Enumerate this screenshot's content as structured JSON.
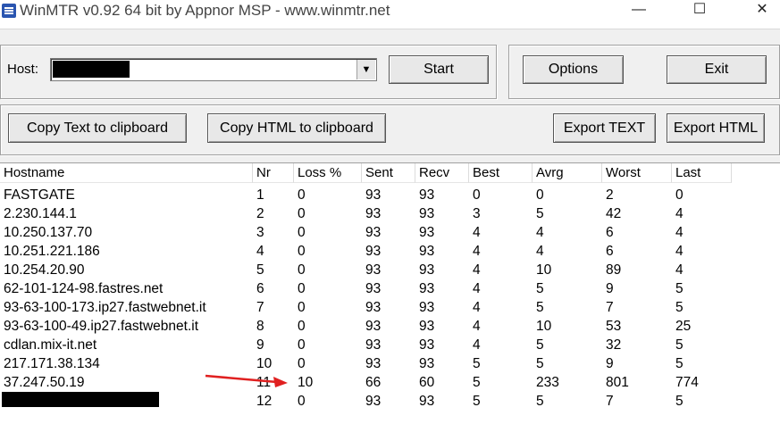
{
  "window": {
    "title": "WinMTR v0.92 64 bit by Appnor MSP - www.winmtr.net",
    "minimize_glyph": "—",
    "maximize_glyph": "☐",
    "close_glyph": "✕"
  },
  "host": {
    "label": "Host:",
    "value": "",
    "dropdown_glyph": "▼"
  },
  "buttons": {
    "start": "Start",
    "options": "Options",
    "exit": "Exit",
    "copy_text": "Copy Text to clipboard",
    "copy_html": "Copy HTML to clipboard",
    "export_text": "Export TEXT",
    "export_html": "Export HTML"
  },
  "table": {
    "columns": [
      "Hostname",
      "Nr",
      "Loss %",
      "Sent",
      "Recv",
      "Best",
      "Avrg",
      "Worst",
      "Last"
    ],
    "rows": [
      [
        "FASTGATE",
        "1",
        "0",
        "93",
        "93",
        "0",
        "0",
        "2",
        "0"
      ],
      [
        "2.230.144.1",
        "2",
        "0",
        "93",
        "93",
        "3",
        "5",
        "42",
        "4"
      ],
      [
        "10.250.137.70",
        "3",
        "0",
        "93",
        "93",
        "4",
        "4",
        "6",
        "4"
      ],
      [
        "10.251.221.186",
        "4",
        "0",
        "93",
        "93",
        "4",
        "4",
        "6",
        "4"
      ],
      [
        "10.254.20.90",
        "5",
        "0",
        "93",
        "93",
        "4",
        "10",
        "89",
        "4"
      ],
      [
        "62-101-124-98.fastres.net",
        "6",
        "0",
        "93",
        "93",
        "4",
        "5",
        "9",
        "5"
      ],
      [
        "93-63-100-173.ip27.fastwebnet.it",
        "7",
        "0",
        "93",
        "93",
        "4",
        "5",
        "7",
        "5"
      ],
      [
        "93-63-100-49.ip27.fastwebnet.it",
        "8",
        "0",
        "93",
        "93",
        "4",
        "10",
        "53",
        "25"
      ],
      [
        "cdlan.mix-it.net",
        "9",
        "0",
        "93",
        "93",
        "4",
        "5",
        "32",
        "5"
      ],
      [
        "217.171.38.134",
        "10",
        "0",
        "93",
        "93",
        "5",
        "5",
        "9",
        "5"
      ],
      [
        "37.247.50.19",
        "11",
        "10",
        "66",
        "60",
        "5",
        "233",
        "801",
        "774"
      ],
      [
        "",
        "12",
        "0",
        "93",
        "93",
        "5",
        "5",
        "7",
        "5"
      ]
    ]
  },
  "annotation": {
    "arrow_color": "#e02020"
  }
}
